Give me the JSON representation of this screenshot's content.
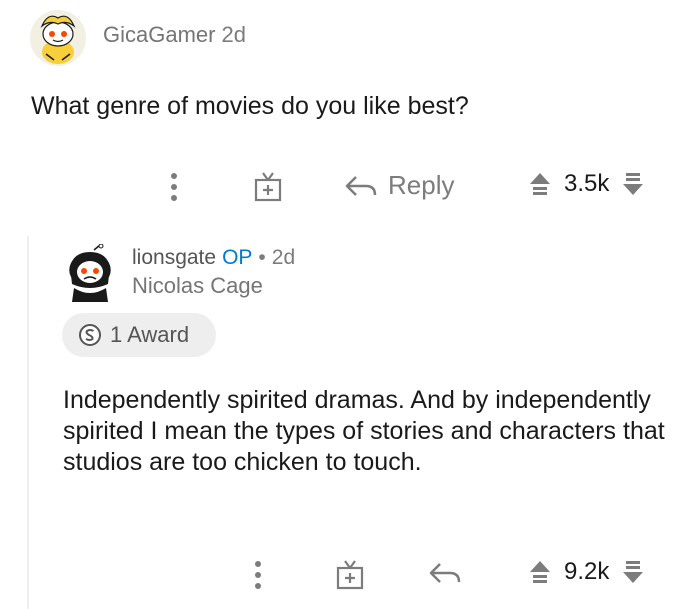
{
  "comment1": {
    "username": "GicaGamer",
    "time": "2d",
    "text": "What genre of movies do you like best?",
    "actions": {
      "more_icon": "more-vertical-icon",
      "gift_icon": "gift-icon",
      "reply_label": "Reply",
      "vote_count": "3.5k"
    }
  },
  "comment2": {
    "username": "lionsgate",
    "op_label": "OP",
    "separator": "•",
    "time": "2d",
    "flair": "Nicolas Cage",
    "award_label": "1 Award",
    "text": "Independently spirited dramas. And by independently spirited I mean the types of stories and characters that studios are too chicken to touch.",
    "actions": {
      "more_icon": "more-vertical-icon",
      "gift_icon": "gift-icon",
      "vote_count": "9.2k"
    }
  },
  "colors": {
    "muted": "#7c7c7c",
    "op_blue": "#0079d3",
    "thread_line": "#edeff1",
    "award_bg": "#eeeeee"
  }
}
